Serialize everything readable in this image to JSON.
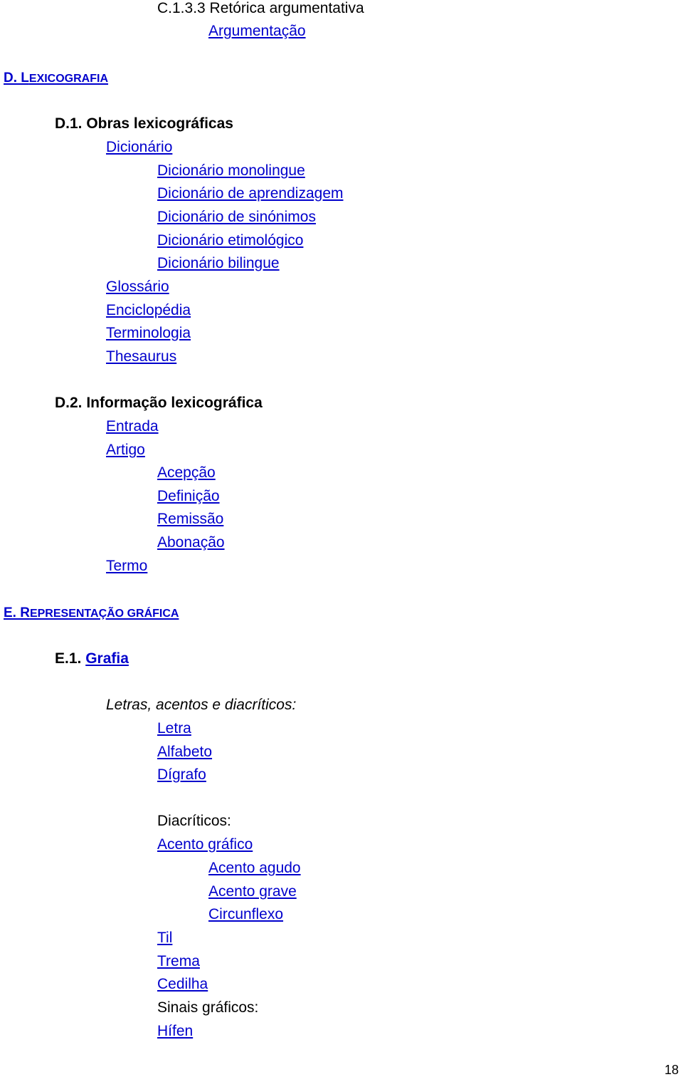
{
  "top": {
    "heading": "C.1.3.3 Retórica argumentativa",
    "link": "Argumentação"
  },
  "sectionD": {
    "title_initial_1": "D. L",
    "title_rest": "EXICOGRAFIA",
    "d1": {
      "title": "D.1. Obras lexicográficas",
      "dicionario": "Dicionário",
      "dicionario_sub": [
        "Dicionário monolingue",
        "Dicionário de aprendizagem",
        "Dicionário de sinónimos",
        "Dicionário etimológico",
        "Dicionário bilingue"
      ],
      "others": [
        "Glossário",
        "Enciclopédia",
        "Terminologia",
        "Thesaurus"
      ]
    },
    "d2": {
      "title": "D.2. Informação lexicográfica",
      "entrada": "Entrada",
      "artigo": "Artigo",
      "artigo_sub": [
        "Acepção",
        "Definição",
        "Remissão",
        "Abonação"
      ],
      "termo": "Termo"
    }
  },
  "sectionE": {
    "title_initial": "E. R",
    "title_rest": "EPRESENTAÇÃO GRÁFICA",
    "e1": {
      "prefix": "E.1. ",
      "link": "Grafia",
      "intro": "Letras, acentos e diacríticos:",
      "letters": [
        "Letra",
        "Alfabeto",
        "Dígrafo"
      ],
      "diacriticos_label": "Diacríticos:",
      "acento_grafico": "Acento gráfico",
      "acento_sub": [
        "Acento agudo",
        "Acento grave",
        "Circunflexo"
      ],
      "other_diacritics": [
        "Til",
        "Trema",
        "Cedilha"
      ],
      "sinais_label": "Sinais gráficos:",
      "hifen": "Hífen"
    }
  },
  "page_number": "18"
}
